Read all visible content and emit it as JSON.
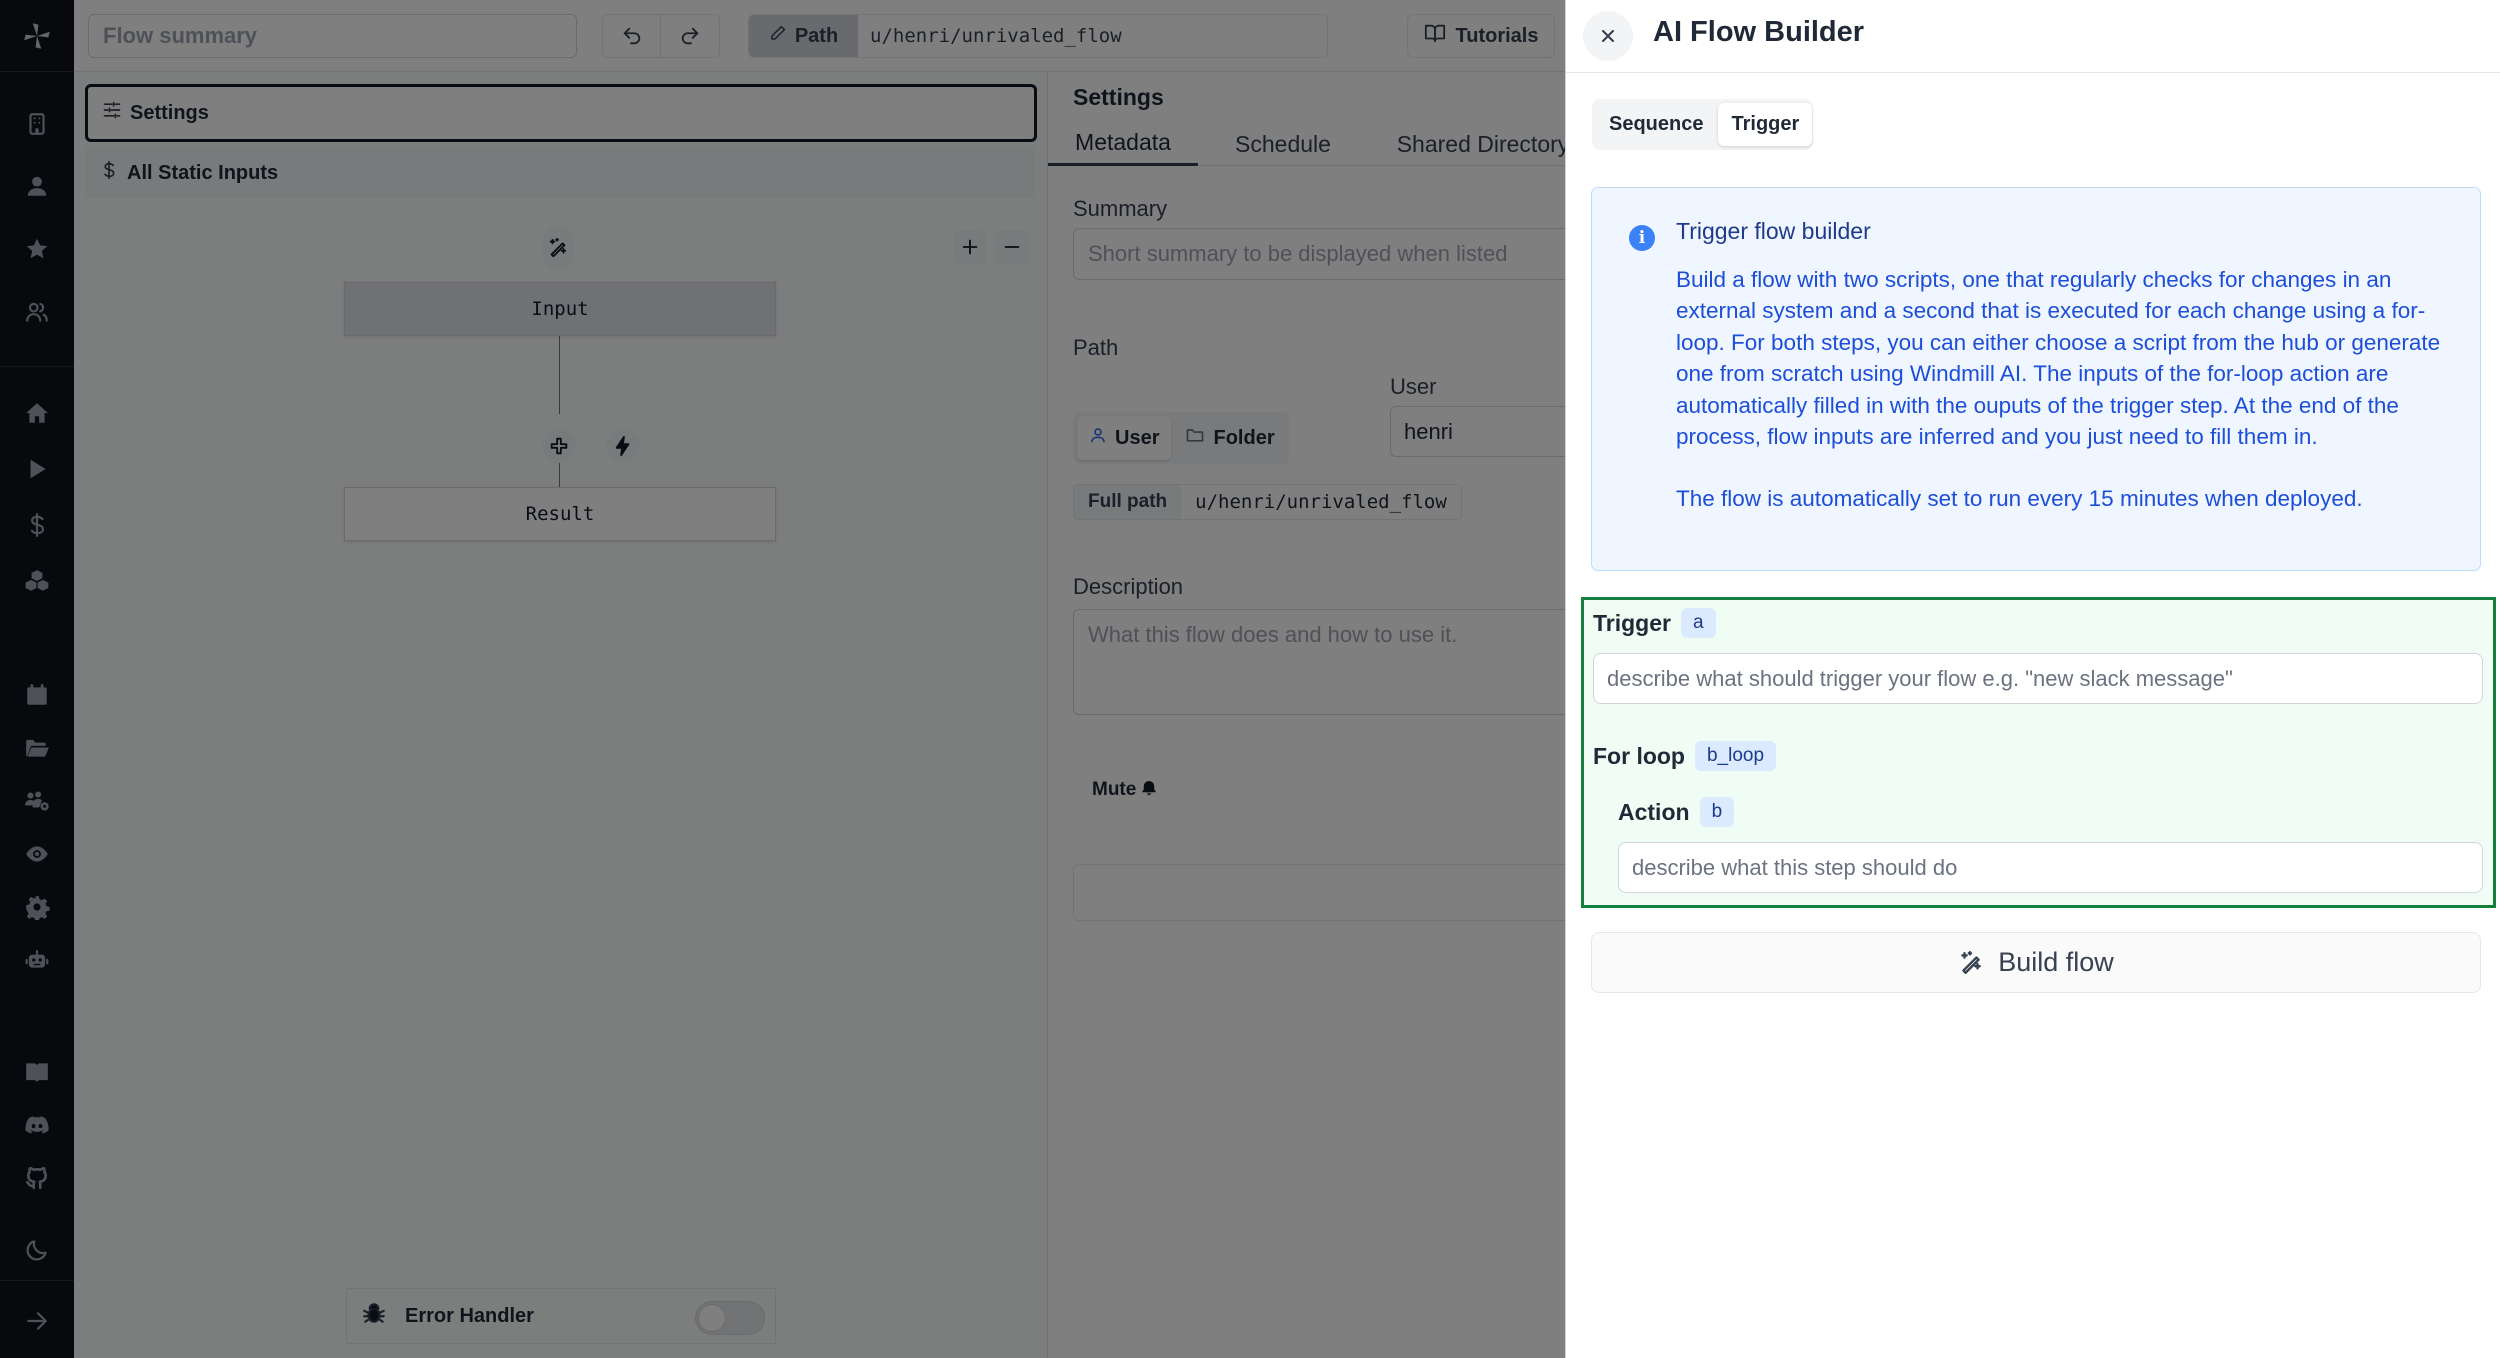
{
  "sidebar": {
    "top_items": [
      {
        "name": "workspace-icon",
        "label": "Workspace"
      },
      {
        "name": "user-icon",
        "label": "User"
      },
      {
        "name": "star-icon",
        "label": "Favorites"
      },
      {
        "name": "users-icon",
        "label": "Groups"
      }
    ],
    "main_items": [
      {
        "name": "home-icon",
        "label": "Home"
      },
      {
        "name": "play-icon",
        "label": "Runs"
      },
      {
        "name": "dollar-icon",
        "label": "Variables"
      },
      {
        "name": "cubes-icon",
        "label": "Resources"
      }
    ],
    "secondary_items": [
      {
        "name": "calendar-icon",
        "label": "Schedules"
      },
      {
        "name": "folder-icon",
        "label": "Folders"
      },
      {
        "name": "user-group-settings-icon",
        "label": "Groups"
      },
      {
        "name": "eye-icon",
        "label": "Audit logs"
      },
      {
        "name": "gear-icon",
        "label": "Workers"
      },
      {
        "name": "robot-icon",
        "label": "Workers robot"
      }
    ],
    "bottom_items": [
      {
        "name": "book-icon",
        "label": "Docs"
      },
      {
        "name": "discord-icon",
        "label": "Discord"
      },
      {
        "name": "github-icon",
        "label": "GitHub"
      },
      {
        "name": "moon-icon",
        "label": "Dark mode"
      }
    ],
    "expand_label": "Expand"
  },
  "topbar": {
    "summary_placeholder": "Flow summary",
    "path_label": "Path",
    "path_value": "u/henri/unrivaled_flow",
    "tutorials_label": "Tutorials"
  },
  "left_panel": {
    "settings_label": "Settings",
    "static_inputs_label": "All Static Inputs",
    "nodes": {
      "input": "Input",
      "result": "Result"
    },
    "error_handler_label": "Error Handler",
    "error_handler_enabled": false
  },
  "settings_panel": {
    "title": "Settings",
    "tabs": [
      "Metadata",
      "Schedule",
      "Shared Directory"
    ],
    "active_tab": "Metadata",
    "summary_label": "Summary",
    "summary_placeholder": "Short summary to be displayed when listed",
    "path_label": "Path",
    "path_toggle": [
      "User",
      "Folder"
    ],
    "user_label": "User",
    "user_value": "henri",
    "full_path_label": "Full path",
    "full_path_value": "u/henri/unrivaled_flow",
    "description_label": "Description",
    "description_placeholder": "What this flow does and how to use it.",
    "mute_label": "Mute"
  },
  "drawer": {
    "title": "AI Flow Builder",
    "tabs": [
      "Sequence",
      "Trigger"
    ],
    "active_tab": "Trigger",
    "info": {
      "title": "Trigger flow builder",
      "body": "Build a flow with two scripts, one that regularly checks for changes in an external system and a second that is executed for each change using a for-loop. For both steps, you can either choose a script from the hub or generate one from scratch using Windmill AI. The inputs of the for-loop action are automatically filled in with the ouputs of the trigger step. At the end of the process, flow inputs are inferred and you just need to fill them in.",
      "note": "The flow is automatically set to run every 15 minutes when deployed."
    },
    "trigger": {
      "label": "Trigger",
      "badge": "a",
      "placeholder": "describe what should trigger your flow e.g. \"new slack message\""
    },
    "for_loop": {
      "label": "For loop",
      "badge": "b_loop"
    },
    "action": {
      "label": "Action",
      "badge": "b",
      "placeholder": "describe what this step should do"
    },
    "build_label": "Build flow"
  },
  "colors": {
    "sidebar_bg": "#0f1219",
    "info_bg": "#eff6ff",
    "info_text": "#1d4ed8",
    "form_border": "#15803d",
    "badge_bg": "#dbeafe"
  }
}
